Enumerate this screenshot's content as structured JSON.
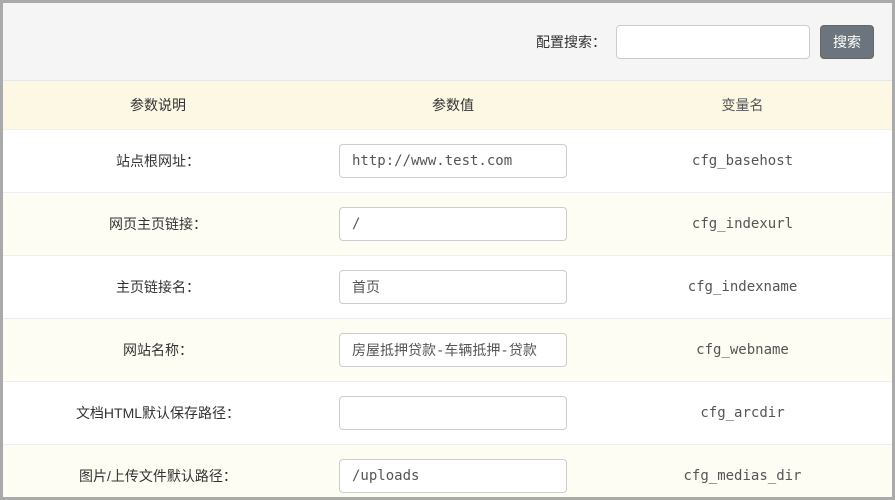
{
  "search": {
    "label": "配置搜索：",
    "value": "",
    "button": "搜索"
  },
  "columns": {
    "desc": "参数说明",
    "value": "参数值",
    "var": "变量名"
  },
  "rows": [
    {
      "desc": "站点根网址：",
      "value": "http://www.test.com",
      "var": "cfg_basehost"
    },
    {
      "desc": "网页主页链接：",
      "value": "/",
      "var": "cfg_indexurl"
    },
    {
      "desc": "主页链接名：",
      "value": "首页",
      "var": "cfg_indexname"
    },
    {
      "desc": "网站名称：",
      "value": "房屋抵押贷款-车辆抵押-贷款",
      "var": "cfg_webname"
    },
    {
      "desc": "文档HTML默认保存路径：",
      "value": "",
      "var": "cfg_arcdir"
    },
    {
      "desc": "图片/上传文件默认路径：",
      "value": "/uploads",
      "var": "cfg_medias_dir"
    }
  ]
}
